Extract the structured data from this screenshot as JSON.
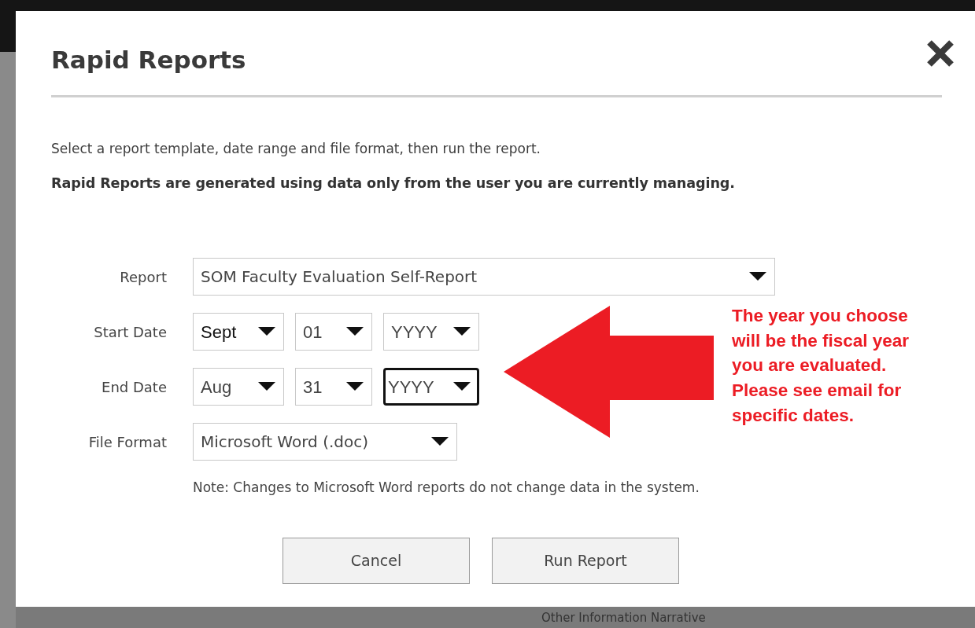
{
  "dialog": {
    "title": "Rapid Reports",
    "intro": "Select a report template, date range and file format, then run the report.",
    "notice": "Rapid Reports are generated using data only from the user you are currently managing.",
    "fields": [
      {
        "label": "Report",
        "kind": "select",
        "parts": [
          {
            "value": "SOM Faculty Evaluation Self-Report",
            "focused": false
          }
        ]
      },
      {
        "label": "Start Date",
        "kind": "date",
        "parts": [
          {
            "value": "Sept",
            "focused": false
          },
          {
            "value": "01",
            "focused": false
          },
          {
            "value": "YYYY",
            "focused": false
          }
        ]
      },
      {
        "label": "End Date",
        "kind": "date",
        "parts": [
          {
            "value": "Aug",
            "focused": false
          },
          {
            "value": "31",
            "focused": false
          },
          {
            "value": "YYYY",
            "focused": true
          }
        ]
      },
      {
        "label": "File Format",
        "kind": "select",
        "parts": [
          {
            "value": "Microsoft Word (.doc)",
            "focused": false
          }
        ]
      }
    ],
    "note": "Note: Changes to Microsoft Word reports do not change data in the system.",
    "buttons": [
      "Cancel",
      "Run Report"
    ]
  },
  "annotation": {
    "text": "The year you choose will be the fiscal year you are evaluated. Please see email for specific dates."
  },
  "background_text": "Other Information Narrative"
}
